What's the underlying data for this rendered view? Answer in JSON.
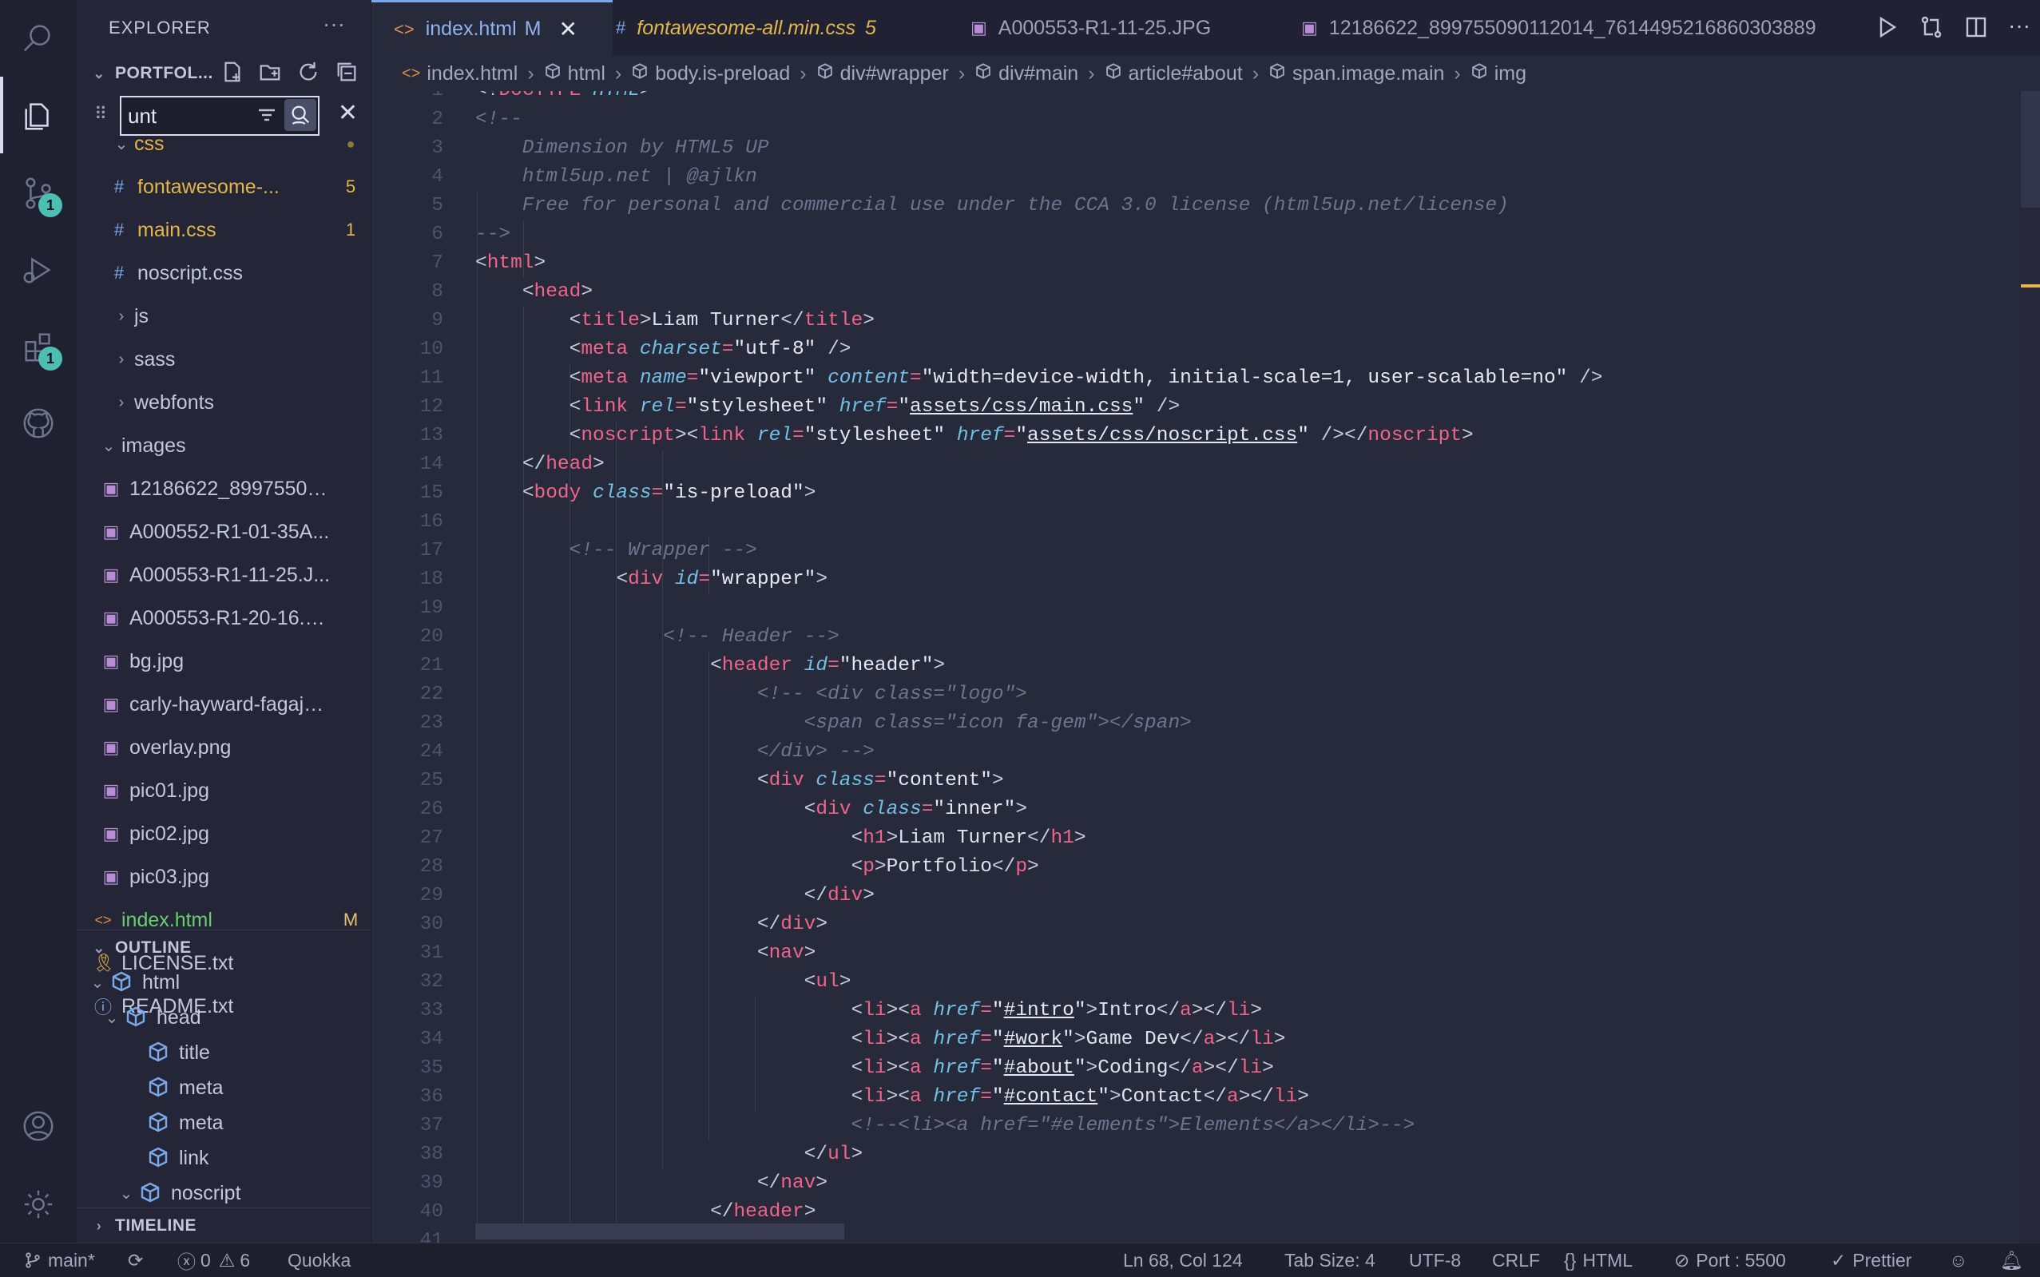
{
  "activity": {
    "items": [
      "search-icon",
      "explorer-icon",
      "source-control-icon",
      "run-debug-icon",
      "extensions-icon",
      "github-icon"
    ],
    "source_control_badge": "1",
    "extensions_badge": "1"
  },
  "explorer": {
    "title": "EXPLORER",
    "more": "···",
    "folder_name": "PORTFOL...",
    "find_value": "unt",
    "tree": [
      {
        "label": "css",
        "type": "folder",
        "open": true,
        "status": "●"
      },
      {
        "label": "fontawesome-...",
        "type": "css",
        "status": "5"
      },
      {
        "label": "main.css",
        "type": "css",
        "status": "1"
      },
      {
        "label": "noscript.css",
        "type": "css",
        "status": ""
      },
      {
        "label": "js",
        "type": "folder",
        "open": false,
        "status": ""
      },
      {
        "label": "sass",
        "type": "folder",
        "open": false,
        "status": ""
      },
      {
        "label": "webfonts",
        "type": "folder",
        "open": false,
        "status": ""
      },
      {
        "label": "images",
        "type": "folder",
        "open": true,
        "status": ""
      },
      {
        "label": "12186622_89975509...",
        "type": "img",
        "status": ""
      },
      {
        "label": "A000552-R1-01-35A...",
        "type": "img",
        "status": ""
      },
      {
        "label": "A000553-R1-11-25.J...",
        "type": "img",
        "status": ""
      },
      {
        "label": "A000553-R1-20-16.J...",
        "type": "img",
        "status": ""
      },
      {
        "label": "bg.jpg",
        "type": "img",
        "status": ""
      },
      {
        "label": "carly-hayward-fagaja...",
        "type": "img",
        "status": ""
      },
      {
        "label": "overlay.png",
        "type": "img",
        "status": ""
      },
      {
        "label": "pic01.jpg",
        "type": "img",
        "status": ""
      },
      {
        "label": "pic02.jpg",
        "type": "img",
        "status": ""
      },
      {
        "label": "pic03.jpg",
        "type": "img",
        "status": ""
      },
      {
        "label": "index.html",
        "type": "html",
        "status": "M"
      },
      {
        "label": "LICENSE.txt",
        "type": "license",
        "status": ""
      },
      {
        "label": "README.txt",
        "type": "info",
        "status": ""
      }
    ]
  },
  "outline": {
    "title": "OUTLINE",
    "items": [
      {
        "label": "html",
        "depth": 0,
        "twisty": "v"
      },
      {
        "label": "head",
        "depth": 1,
        "twisty": "v"
      },
      {
        "label": "title",
        "depth": 2,
        "twisty": ""
      },
      {
        "label": "meta",
        "depth": 2,
        "twisty": ""
      },
      {
        "label": "meta",
        "depth": 2,
        "twisty": ""
      },
      {
        "label": "link",
        "depth": 2,
        "twisty": ""
      },
      {
        "label": "noscript",
        "depth": 2,
        "twisty": "v"
      }
    ]
  },
  "timeline": {
    "title": "TIMELINE"
  },
  "tabs": [
    {
      "label": "index.html",
      "suffix": "M",
      "icon": "<>",
      "active": true,
      "closable": true
    },
    {
      "label": "fontawesome-all.min.css",
      "suffix": "5",
      "icon": "#",
      "active": false
    },
    {
      "label": "A000553-R1-11-25.JPG",
      "suffix": "",
      "icon": "img",
      "active": false
    },
    {
      "label": "12186622_899755090112014_7614495216860303889",
      "suffix": "",
      "icon": "img",
      "active": false
    }
  ],
  "breadcrumb": [
    "index.html",
    "html",
    "body.is-preload",
    "div#wrapper",
    "div#main",
    "article#about",
    "span.image.main",
    "img"
  ],
  "code": {
    "line_numbers": [
      "1",
      "2",
      "3",
      "4",
      "5",
      "6",
      "7",
      "8",
      "9",
      "10",
      "11",
      "12",
      "13",
      "14",
      "15",
      "16",
      "17",
      "18",
      "19",
      "20",
      "21",
      "22",
      "23",
      "24",
      "25",
      "26",
      "27",
      "28",
      "29",
      "30",
      "31",
      "32",
      "33",
      "34",
      "35",
      "36",
      "37",
      "38",
      "39",
      "40",
      "41"
    ]
  },
  "status": {
    "branch": "main*",
    "errors": "0",
    "warnings": "6",
    "quokka": "Quokka",
    "position": "Ln 68, Col 124",
    "tab_size": "Tab Size: 4",
    "encoding": "UTF-8",
    "eol": "CRLF",
    "language": "HTML",
    "port": "Port : 5500",
    "prettier": "Prettier"
  }
}
